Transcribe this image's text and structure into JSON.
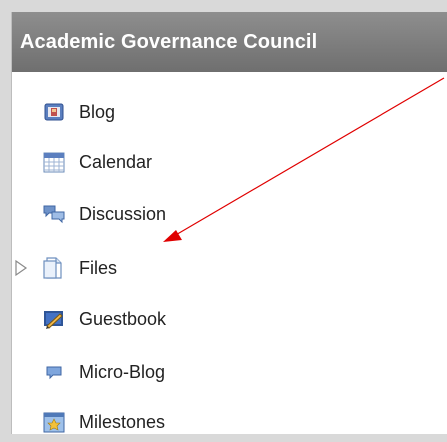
{
  "header": {
    "title": "Academic Governance Council"
  },
  "nav": {
    "items": [
      {
        "label": "Blog",
        "icon": "blog-icon"
      },
      {
        "label": "Calendar",
        "icon": "calendar-icon"
      },
      {
        "label": "Discussion",
        "icon": "discussion-icon"
      },
      {
        "label": "Files",
        "icon": "files-icon",
        "expandable": true
      },
      {
        "label": "Guestbook",
        "icon": "guestbook-icon"
      },
      {
        "label": "Micro-Blog",
        "icon": "micro-blog-icon"
      },
      {
        "label": "Milestones",
        "icon": "milestones-icon"
      }
    ]
  },
  "colors": {
    "header_bg": "#7f7f7f",
    "annotation_arrow": "#e00000"
  }
}
